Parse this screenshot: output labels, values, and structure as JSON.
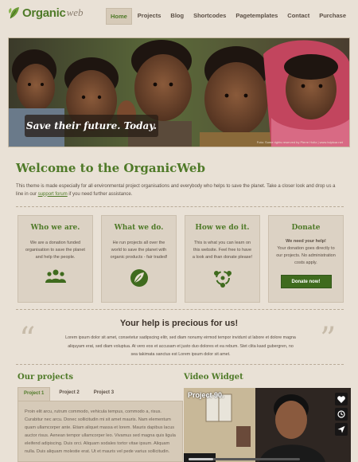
{
  "header": {
    "logo_main": "Organic",
    "logo_sub": "web",
    "nav": [
      "Home",
      "Projects",
      "Blog",
      "Shortcodes",
      "Pagetemplates",
      "Contact",
      "Purchase"
    ],
    "active_nav": "Home"
  },
  "hero": {
    "slogan": "Save their future. Today.",
    "credit": "Foto: Some rights reserved by Pierre Holtz | www.hdptcar.net"
  },
  "welcome": {
    "title": "Welcome to the OrganicWeb",
    "text_before_link": "This theme is made especially for all environmental project organisations and everybody who helps to save the planet. Take a closer look and drop us a line in our ",
    "link": "support forum",
    "text_after_link": " if you need further assistance."
  },
  "boxes": [
    {
      "title": "Who we are.",
      "text": "We are a donation funded organisation to save the planet and help the people.",
      "icon": "people-icon"
    },
    {
      "title": "What we do.",
      "text": "He run projects all over the world to save the planet with organic products - fair traded!",
      "icon": "leaf-icon"
    },
    {
      "title": "How we do it.",
      "text": "This is what you can learn on this website. Feel free to have a look and than donate please!",
      "icon": "recycle-icon"
    },
    {
      "title": "Donate",
      "text_bold": "We need your help!",
      "text": "Your donation goes directly to our projects. No administration costs apply.",
      "button": "Donate now!"
    }
  ],
  "help": {
    "title": "Your help is precious for us!",
    "text": "Lorem ipsum dolor sit amet, consetetur sadipscing elitr, sed diam nonumy eirmod tempor invidunt ut labore et dolore magna aliquyam erat, sed diam voluptua. At vero eos et accusam et justo duo dolores et ea rebum. Stet clita kasd gubergren, no sea takimata sanctus est Lorem ipsum dolor sit amet."
  },
  "projects": {
    "title": "Our projects",
    "tabs": [
      "Project 1",
      "Project 2",
      "Project 3"
    ],
    "active_tab": "Project 1",
    "text": "Proin elit arcu, rutrum commodo, vehicula tempus, commodo a, risus. Curabitur nec arcu. Donec sollicitudin mi sit amet mauris. Nam elementum quam ullamcorper ante. Etiam aliquet massa et lorem. Mauris dapibus lacus auctor risus. Aenean tempor ullamcorper leo. Vivamus sed magna quis ligula eleifend adipiscing. Duis orci. Aliquam sodales tortor vitae ipsum. Aliquam nulla. Duis aliquam molestie erat. Ut et mauris vel pede varius sollicitudin."
  },
  "video": {
    "section_title": "Video Widget",
    "title": "Project 90."
  },
  "colors": {
    "accent": "#4f7a28",
    "background": "#e9e1d6",
    "box": "#dcd2c4"
  }
}
